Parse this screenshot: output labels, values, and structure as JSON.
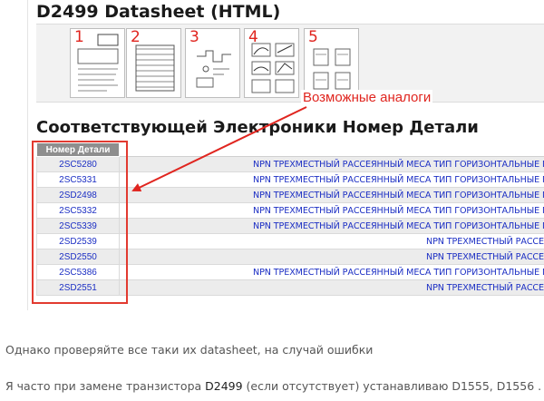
{
  "screenshot": {
    "datasheet_title": "D2499 Datasheet (HTML)",
    "thumbnails": [
      {
        "number": "1"
      },
      {
        "number": "2"
      },
      {
        "number": "3"
      },
      {
        "number": "4"
      },
      {
        "number": "5"
      }
    ],
    "section_title": "Соответствующей Электроники Номер Детали",
    "table": {
      "part_header": "Номер Детали",
      "rows": [
        {
          "part": "2SC5280",
          "desc": "NPN ТРЕХМЕСТНЫЙ РАССЕЯННЫЙ МЕСА ТИП ГОРИЗОНТАЛЬНЫЕ ПРОГИБ ВЫХОД"
        },
        {
          "part": "2SC5331",
          "desc": "NPN ТРЕХМЕСТНЫЙ РАССЕЯННЫЙ МЕСА ТИП ГОРИЗОНТАЛЬНЫЕ ПРОГИБ ВЫХОД"
        },
        {
          "part": "2SD2498",
          "desc": "NPN ТРЕХМЕСТНЫЙ РАССЕЯННЫЙ МЕСА ТИП ГОРИЗОНТАЛЬНЫЕ ПРОГИБ ВЫХОД"
        },
        {
          "part": "2SC5332",
          "desc": "NPN ТРЕХМЕСТНЫЙ РАССЕЯННЫЙ МЕСА ТИП ГОРИЗОНТАЛЬНЫЕ ПРОГИБ ВЫХОД"
        },
        {
          "part": "2SC5339",
          "desc": "NPN ТРЕХМЕСТНЫЙ РАССЕЯННЫЙ МЕСА ТИП ГОРИЗОНТАЛЬНЫЕ ПРОГИБ ВЫХОД"
        },
        {
          "part": "2SD2539",
          "desc": "NPN ТРЕХМЕСТНЫЙ РАССЕЯННЫЙ М"
        },
        {
          "part": "2SD2550",
          "desc": "NPN ТРЕХМЕСТНЫЙ РАССЕЯННЫЙ М"
        },
        {
          "part": "2SC5386",
          "desc": "NPN ТРЕХМЕСТНЫЙ РАССЕЯННЫЙ МЕСА ТИП ГОРИЗОНТАЛЬНЫЕ ПРОГИБ ВЫХОД"
        },
        {
          "part": "2SD2551",
          "desc": "NPN ТРЕХМЕСТНЫЙ РАССЕЯННЫЙ М"
        }
      ]
    }
  },
  "annotation": {
    "label": "Возможные аналоги",
    "color": "#e0251f"
  },
  "article": {
    "line1": "Однако проверяйте все таки их datasheet, на случай ошибки",
    "line2_before": "Я часто при замене транзистора ",
    "line2_bold": "D2499",
    "line2_after": " (если отсутствует) устанавливаю D1555, D1556 ."
  }
}
